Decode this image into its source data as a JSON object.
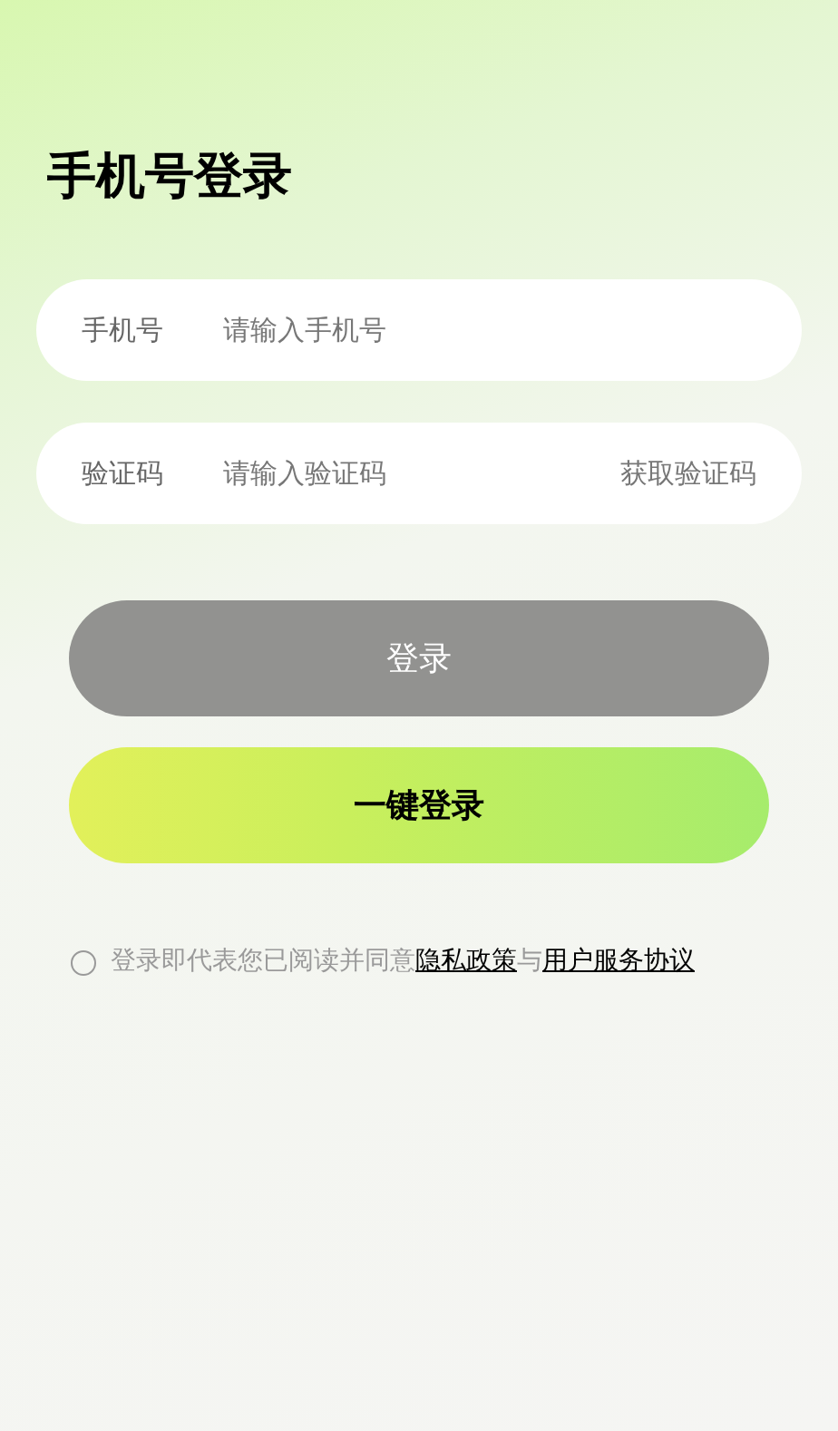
{
  "title": "手机号登录",
  "fields": [
    {
      "label": "手机号",
      "placeholder": "请输入手机号"
    },
    {
      "label": "验证码",
      "placeholder": "请输入验证码",
      "action": "获取验证码"
    }
  ],
  "buttons": [
    {
      "kind": "login",
      "label": "登录",
      "disabled": true
    },
    {
      "kind": "quick",
      "label": "一键登录",
      "disabled": false
    }
  ],
  "agreement": {
    "checked": false,
    "text": "登录即代表您已阅读并同意",
    "privacy_link": "隐私政策",
    "joiner": "与",
    "terms_link": "用户服务协议"
  }
}
